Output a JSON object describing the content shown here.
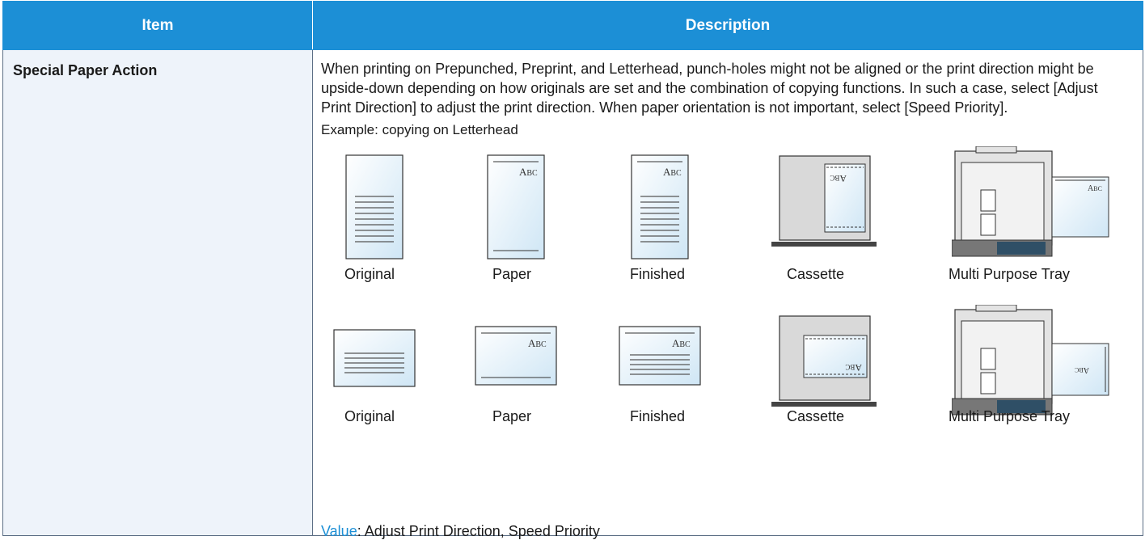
{
  "header": {
    "item": "Item",
    "description": "Description"
  },
  "row": {
    "item": "Special Paper Action",
    "description": "When printing on Prepunched, Preprint, and Letterhead, punch-holes might not be aligned or the print direction might be upside-down depending on how originals are set and the combination of copying functions. In such a case, select [Adjust Print Direction] to adjust the print direction. When paper orientation is not important, select [Speed Priority].",
    "example": "Example: copying on Letterhead",
    "figure_labels": {
      "original": "Original",
      "paper": "Paper",
      "finished": "Finished",
      "cassette": "Cassette",
      "mpt": "Multi Purpose Tray"
    },
    "paper_mark": "Abc",
    "value_key": "Value",
    "value_text": ": Adjust Print Direction, Speed Priority"
  },
  "colors": {
    "header_bg": "#1c8fd6",
    "item_bg": "#eef3fa",
    "border": "#5d6f86",
    "value_key": "#1c8fd6"
  }
}
